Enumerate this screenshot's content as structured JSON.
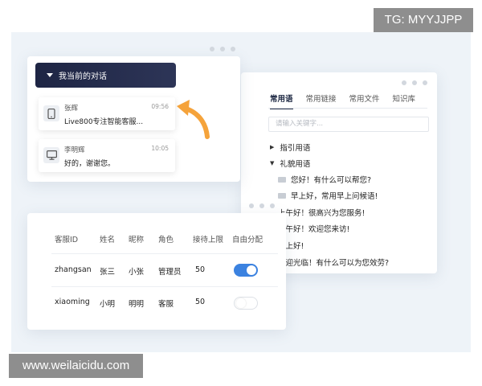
{
  "watermark": {
    "tg": "TG: MYYJJPP",
    "site": "www.weilaicidu.com"
  },
  "conversations": {
    "header": "我当前的对话",
    "items": [
      {
        "name": "张辉",
        "time": "09:56",
        "message": "Live800专注智能客服...",
        "icon": "mobile-phone-icon"
      },
      {
        "name": "李明辉",
        "time": "10:05",
        "message": "好的，谢谢您。",
        "icon": "desktop-computer-icon"
      }
    ]
  },
  "phrases": {
    "tabs": [
      "常用语",
      "常用链接",
      "常用文件",
      "知识库"
    ],
    "active_tab": "常用语",
    "search_placeholder": "请输入关键字...",
    "groups": [
      {
        "label": "指引用语",
        "expanded": false
      },
      {
        "label": "礼貌用语",
        "expanded": true
      }
    ],
    "items": [
      {
        "text": "您好！有什么可以帮您?",
        "icon": true
      },
      {
        "text": "早上好，常用早上问候语!",
        "icon": true
      },
      {
        "text": "上午好！很高兴为您服务!",
        "icon": false
      },
      {
        "text": "下午好！欢迎您来访!",
        "icon": false
      },
      {
        "text": "晚上好!",
        "icon": false
      },
      {
        "text": "欢迎光临！有什么可以为您效劳?",
        "icon": false
      }
    ]
  },
  "agents": {
    "headers": [
      "客服ID",
      "姓名",
      "昵称",
      "角色",
      "接待上限",
      "自由分配"
    ],
    "rows": [
      {
        "id": "zhangsan",
        "name": "张三",
        "nickname": "小张",
        "role": "管理员",
        "limit": "50",
        "auto_assign": true
      },
      {
        "id": "xiaoming",
        "name": "小明",
        "nickname": "明明",
        "role": "客服",
        "limit": "50",
        "auto_assign": false
      }
    ]
  },
  "colors": {
    "accent": "#3b82e0",
    "header_bg": "#1e2544",
    "arrow": "#f5a33b"
  }
}
